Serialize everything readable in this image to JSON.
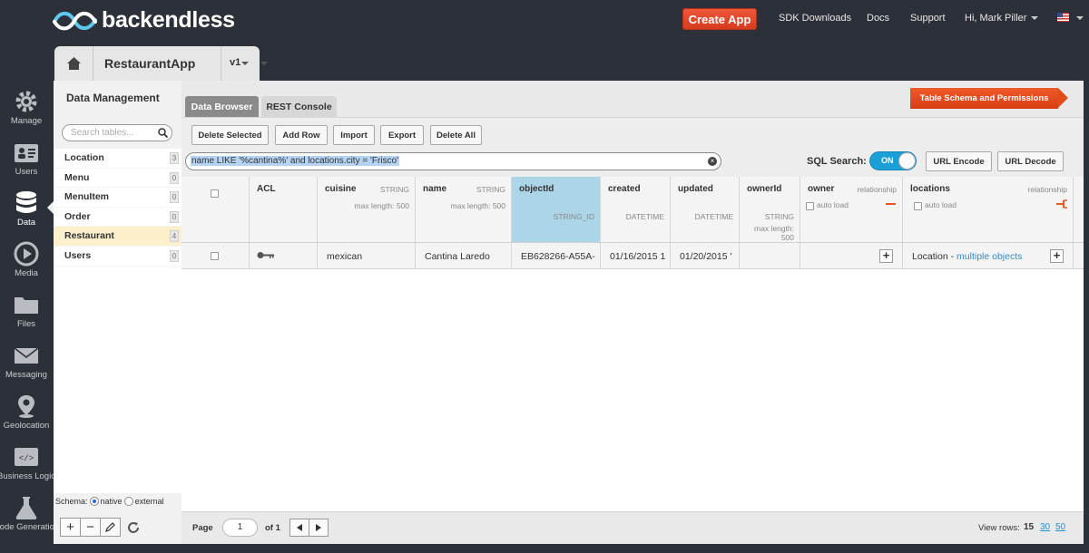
{
  "brand": {
    "name": "backendless"
  },
  "topnav": {
    "create_app": "Create App",
    "sdk_downloads": "SDK Downloads",
    "docs": "Docs",
    "support": "Support",
    "user": "Hi, Mark Piller"
  },
  "app": {
    "name": "RestaurantApp",
    "version": "v1"
  },
  "leftnav": [
    {
      "label": "Manage"
    },
    {
      "label": "Users"
    },
    {
      "label": "Data"
    },
    {
      "label": "Media"
    },
    {
      "label": "Files"
    },
    {
      "label": "Messaging"
    },
    {
      "label": "Geolocation"
    },
    {
      "label": "Business Logic"
    },
    {
      "label": "Code Generation"
    }
  ],
  "data_panel": {
    "title": "Data Management",
    "search_placeholder": "Search tables...",
    "tables": [
      {
        "name": "Location",
        "count": "3"
      },
      {
        "name": "Menu",
        "count": "0"
      },
      {
        "name": "MenuItem",
        "count": "0"
      },
      {
        "name": "Order",
        "count": "0"
      },
      {
        "name": "Restaurant",
        "count": "4",
        "selected": true
      },
      {
        "name": "Users",
        "count": "0"
      }
    ],
    "schema_label": "Schema:",
    "schema_native": "native",
    "schema_external": "external",
    "schema_selected": "native"
  },
  "tabs": {
    "data_browser": "Data Browser",
    "rest_console": "REST Console",
    "schema": "Table Schema and Permissions"
  },
  "toolbar": {
    "delete_selected": "Delete Selected",
    "add_row": "Add Row",
    "import": "Import",
    "export": "Export",
    "delete_all": "Delete All",
    "query": "name LIKE '%cantina%' and locations.city = 'Frisco'",
    "sql_search_label": "SQL Search:",
    "sql_toggle": "ON",
    "url_encode": "URL Encode",
    "url_decode": "URL Decode"
  },
  "columns": {
    "acl": {
      "name": "ACL"
    },
    "cuisine": {
      "name": "cuisine",
      "type": "STRING",
      "sub": "max length: 500"
    },
    "name": {
      "name": "name",
      "type": "STRING",
      "sub": "max length: 500"
    },
    "objectId": {
      "name": "objectId",
      "sub": "STRING_ID"
    },
    "created": {
      "name": "created",
      "sub": "DATETIME"
    },
    "updated": {
      "name": "updated",
      "sub": "DATETIME"
    },
    "ownerId": {
      "name": "ownerId",
      "sub": "STRING",
      "sub2": "max length: 500"
    },
    "owner": {
      "name": "owner",
      "type": "relationship",
      "auto": "auto load"
    },
    "locations": {
      "name": "locations",
      "type": "relationship",
      "auto": "auto load"
    }
  },
  "rows": [
    {
      "cuisine": "mexican",
      "name": "Cantina Laredo",
      "objectId": "EB628266-A55A-",
      "created": "01/16/2015 1",
      "updated": "01/20/2015 '",
      "locations_prefix": "Location - ",
      "locations_link": "multiple objects"
    }
  ],
  "footer": {
    "page_label": "Page",
    "page": "1",
    "of": "of 1",
    "view_rows": "View rows:",
    "rows_options": [
      "15",
      "30",
      "50"
    ],
    "rows_selected": "15"
  },
  "colors": {
    "accent": "#1a9fd6",
    "create": "#e04a2c",
    "selected_row": "#fbf0cb",
    "id_col": "#acd6e8"
  }
}
